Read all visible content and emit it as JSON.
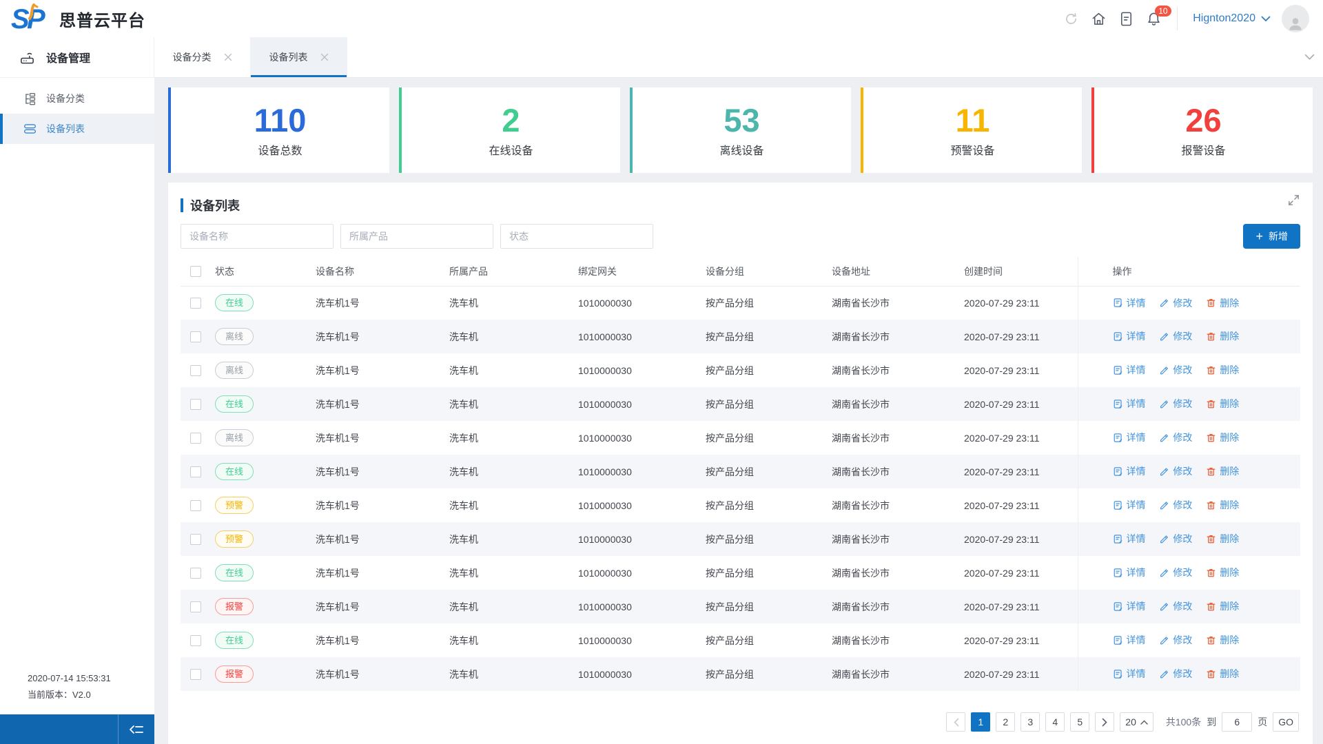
{
  "header": {
    "app_title": "思普云平台",
    "notification_count": "10",
    "username": "Hignton2020"
  },
  "sidebar": {
    "section_label": "设备管理",
    "items": [
      {
        "label": "设备分类"
      },
      {
        "label": "设备列表"
      }
    ],
    "footer": {
      "timestamp": "2020-07-14 15:53:31",
      "version_label": "当前版本：V2.0"
    }
  },
  "tabs": [
    {
      "label": "设备分类",
      "active": false
    },
    {
      "label": "设备列表",
      "active": true
    }
  ],
  "stats": [
    {
      "value": "110",
      "label": "设备总数",
      "color": "#2b6bd9"
    },
    {
      "value": "2",
      "label": "在线设备",
      "color": "#3fce90"
    },
    {
      "value": "53",
      "label": "离线设备",
      "color": "#4db6ac"
    },
    {
      "value": "11",
      "label": "预警设备",
      "color": "#f7b500"
    },
    {
      "value": "26",
      "label": "报警设备",
      "color": "#f2403d"
    }
  ],
  "panel": {
    "title": "设备列表",
    "filters": [
      {
        "placeholder": "设备名称"
      },
      {
        "placeholder": "所属产品"
      },
      {
        "placeholder": "状态"
      }
    ],
    "add_button_label": "新增"
  },
  "table": {
    "columns": [
      "状态",
      "设备名称",
      "所属产品",
      "绑定网关",
      "设备分组",
      "设备地址",
      "创建时间",
      "操作"
    ],
    "actions": {
      "detail": "详情",
      "edit": "修改",
      "delete": "删除"
    },
    "rows": [
      {
        "status": "在线",
        "status_type": "online",
        "name": "洗车机1号",
        "product": "洗车机",
        "gateway": "1010000030",
        "group": "按产品分组",
        "address": "湖南省长沙市",
        "created": "2020-07-29 23:11"
      },
      {
        "status": "离线",
        "status_type": "offline",
        "name": "洗车机1号",
        "product": "洗车机",
        "gateway": "1010000030",
        "group": "按产品分组",
        "address": "湖南省长沙市",
        "created": "2020-07-29 23:11"
      },
      {
        "status": "离线",
        "status_type": "offline",
        "name": "洗车机1号",
        "product": "洗车机",
        "gateway": "1010000030",
        "group": "按产品分组",
        "address": "湖南省长沙市",
        "created": "2020-07-29 23:11"
      },
      {
        "status": "在线",
        "status_type": "online",
        "name": "洗车机1号",
        "product": "洗车机",
        "gateway": "1010000030",
        "group": "按产品分组",
        "address": "湖南省长沙市",
        "created": "2020-07-29 23:11"
      },
      {
        "status": "离线",
        "status_type": "offline",
        "name": "洗车机1号",
        "product": "洗车机",
        "gateway": "1010000030",
        "group": "按产品分组",
        "address": "湖南省长沙市",
        "created": "2020-07-29 23:11"
      },
      {
        "status": "在线",
        "status_type": "online",
        "name": "洗车机1号",
        "product": "洗车机",
        "gateway": "1010000030",
        "group": "按产品分组",
        "address": "湖南省长沙市",
        "created": "2020-07-29 23:11"
      },
      {
        "status": "预警",
        "status_type": "warning",
        "name": "洗车机1号",
        "product": "洗车机",
        "gateway": "1010000030",
        "group": "按产品分组",
        "address": "湖南省长沙市",
        "created": "2020-07-29 23:11"
      },
      {
        "status": "预警",
        "status_type": "warning",
        "name": "洗车机1号",
        "product": "洗车机",
        "gateway": "1010000030",
        "group": "按产品分组",
        "address": "湖南省长沙市",
        "created": "2020-07-29 23:11"
      },
      {
        "status": "在线",
        "status_type": "online",
        "name": "洗车机1号",
        "product": "洗车机",
        "gateway": "1010000030",
        "group": "按产品分组",
        "address": "湖南省长沙市",
        "created": "2020-07-29 23:11"
      },
      {
        "status": "报警",
        "status_type": "alarm",
        "name": "洗车机1号",
        "product": "洗车机",
        "gateway": "1010000030",
        "group": "按产品分组",
        "address": "湖南省长沙市",
        "created": "2020-07-29 23:11"
      },
      {
        "status": "在线",
        "status_type": "online",
        "name": "洗车机1号",
        "product": "洗车机",
        "gateway": "1010000030",
        "group": "按产品分组",
        "address": "湖南省长沙市",
        "created": "2020-07-29 23:11"
      },
      {
        "status": "报警",
        "status_type": "alarm",
        "name": "洗车机1号",
        "product": "洗车机",
        "gateway": "1010000030",
        "group": "按产品分组",
        "address": "湖南省长沙市",
        "created": "2020-07-29 23:11"
      }
    ]
  },
  "pagination": {
    "pages": [
      "1",
      "2",
      "3",
      "4",
      "5"
    ],
    "current_page": "1",
    "page_size": "20",
    "total_text": "共100条",
    "to_label": "到",
    "goto_value": "6",
    "page_label": "页",
    "go_label": "GO"
  }
}
